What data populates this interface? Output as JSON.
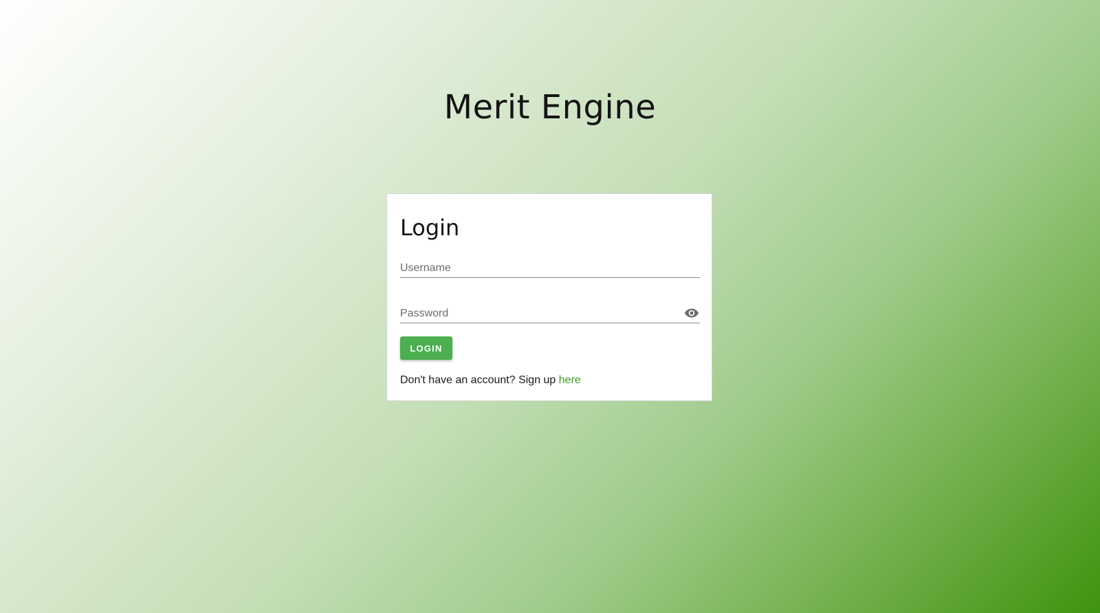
{
  "app": {
    "title": "Merit Engine"
  },
  "login_card": {
    "heading": "Login",
    "username": {
      "placeholder": "Username",
      "value": ""
    },
    "password": {
      "placeholder": "Password",
      "value": "",
      "toggle_icon": "eye-icon"
    },
    "submit_label": "LOGIN",
    "signup_prompt": "Don't have an account? Sign up",
    "signup_link": "here"
  },
  "colors": {
    "accent": "#4caf50",
    "link": "#3d9a1c",
    "gradient_start": "#ffffff",
    "gradient_end": "#3f930f"
  }
}
